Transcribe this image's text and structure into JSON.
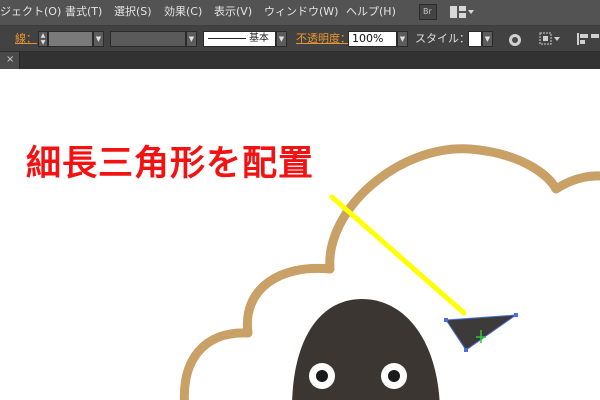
{
  "menubar": {
    "items": [
      "ジェクト(O)",
      "書式(T)",
      "選択(S)",
      "効果(C)",
      "表示(V)",
      "ウィンドウ(W)",
      "ヘルプ(H)"
    ],
    "bridge_icon_text": "Br",
    "icons": [
      "bridge-icon",
      "arrange-documents-icon"
    ]
  },
  "controlbar": {
    "stroke_label": "線：",
    "stroke_style_value": "基本",
    "opacity_label": "不透明度：",
    "opacity_value": "100%",
    "style_label": "スタイル：",
    "icons": [
      "recolor-artwork-icon",
      "align-grid-icon",
      "align-icon"
    ]
  },
  "document_tab": {
    "close_glyph": "×"
  },
  "canvas": {
    "annotation_text": "細長三角形を配置",
    "annotation_color": "#f21212",
    "cloud_stroke_color": "#c9a065",
    "sheep_face_color": "#3b3632",
    "pointer_line_color": "#ffff00",
    "selected_triangle_color": "#3d3a3a",
    "selection_color": "#4b6fd8"
  }
}
